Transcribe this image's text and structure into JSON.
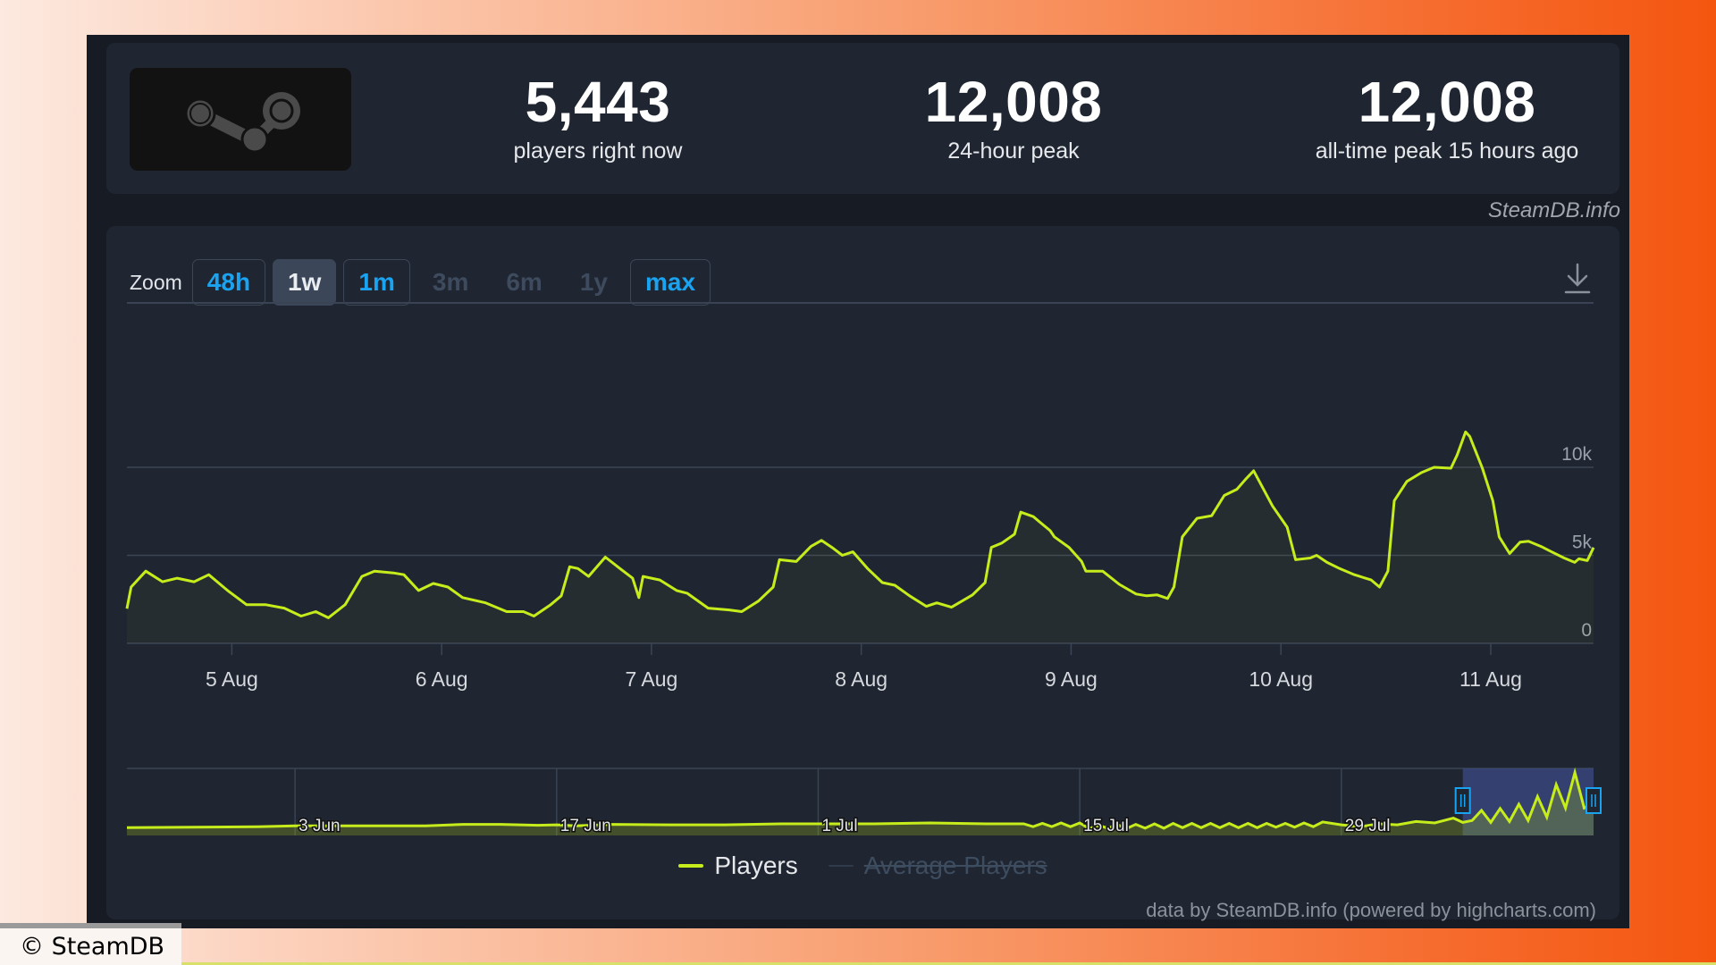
{
  "header": {
    "logo_icon": "steam-logo-icon",
    "stats": [
      {
        "value": "5,443",
        "label": "players right now"
      },
      {
        "value": "12,008",
        "label": "24-hour peak"
      },
      {
        "value": "12,008",
        "label": "all-time peak 15 hours ago"
      }
    ],
    "watermark": "SteamDB.info"
  },
  "toolbar": {
    "zoom_label": "Zoom",
    "zoom_buttons": [
      {
        "label": "48h",
        "state": "enabled"
      },
      {
        "label": "1w",
        "state": "active"
      },
      {
        "label": "1m",
        "state": "enabled"
      },
      {
        "label": "3m",
        "state": "disabled"
      },
      {
        "label": "6m",
        "state": "disabled"
      },
      {
        "label": "1y",
        "state": "disabled"
      },
      {
        "label": "max",
        "state": "enabled"
      }
    ],
    "download_icon": "download-icon"
  },
  "colors": {
    "series": "#c6ec1c",
    "accent": "#1aa3f0",
    "panel": "#1f2631",
    "navigator_selection": "#3c4a86"
  },
  "chart_data": {
    "type": "line",
    "title": "",
    "xlabel": "",
    "ylabel": "",
    "x_unit": "day of August (fractional)",
    "xlim": [
      4.5,
      11.49
    ],
    "ylim": [
      0,
      12500
    ],
    "grid": true,
    "y_ticks": [
      {
        "value": 0,
        "label": "0"
      },
      {
        "value": 5000,
        "label": "5k"
      },
      {
        "value": 10000,
        "label": "10k"
      }
    ],
    "x_ticks": [
      {
        "value": 5,
        "label": "5 Aug"
      },
      {
        "value": 6,
        "label": "6 Aug"
      },
      {
        "value": 7,
        "label": "7 Aug"
      },
      {
        "value": 8,
        "label": "8 Aug"
      },
      {
        "value": 9,
        "label": "9 Aug"
      },
      {
        "value": 10,
        "label": "10 Aug"
      },
      {
        "value": 11,
        "label": "11 Aug"
      }
    ],
    "series": [
      {
        "name": "Players",
        "visible": true,
        "points": [
          [
            4.5,
            1970
          ],
          [
            4.52,
            3200
          ],
          [
            4.59,
            4100
          ],
          [
            4.67,
            3500
          ],
          [
            4.74,
            3700
          ],
          [
            4.82,
            3500
          ],
          [
            4.89,
            3900
          ],
          [
            4.98,
            3000
          ],
          [
            5.07,
            2200
          ],
          [
            5.16,
            2200
          ],
          [
            5.25,
            2000
          ],
          [
            5.33,
            1550
          ],
          [
            5.4,
            1800
          ],
          [
            5.46,
            1450
          ],
          [
            5.54,
            2200
          ],
          [
            5.62,
            3800
          ],
          [
            5.68,
            4100
          ],
          [
            5.77,
            4000
          ],
          [
            5.82,
            3900
          ],
          [
            5.89,
            3000
          ],
          [
            5.96,
            3400
          ],
          [
            6.03,
            3200
          ],
          [
            6.1,
            2600
          ],
          [
            6.21,
            2300
          ],
          [
            6.31,
            1800
          ],
          [
            6.39,
            1800
          ],
          [
            6.44,
            1550
          ],
          [
            6.52,
            2200
          ],
          [
            6.57,
            2700
          ],
          [
            6.61,
            4350
          ],
          [
            6.65,
            4250
          ],
          [
            6.7,
            3800
          ],
          [
            6.78,
            4900
          ],
          [
            6.85,
            4250
          ],
          [
            6.91,
            3700
          ],
          [
            6.94,
            2600
          ],
          [
            6.96,
            3800
          ],
          [
            7.04,
            3600
          ],
          [
            7.12,
            3000
          ],
          [
            7.17,
            2850
          ],
          [
            7.27,
            2000
          ],
          [
            7.37,
            1900
          ],
          [
            7.43,
            1800
          ],
          [
            7.51,
            2400
          ],
          [
            7.58,
            3200
          ],
          [
            7.61,
            4750
          ],
          [
            7.69,
            4650
          ],
          [
            7.76,
            5500
          ],
          [
            7.81,
            5850
          ],
          [
            7.86,
            5450
          ],
          [
            7.91,
            5000
          ],
          [
            7.96,
            5200
          ],
          [
            8.03,
            4250
          ],
          [
            8.1,
            3450
          ],
          [
            8.16,
            3300
          ],
          [
            8.23,
            2700
          ],
          [
            8.31,
            2100
          ],
          [
            8.36,
            2300
          ],
          [
            8.43,
            2050
          ],
          [
            8.53,
            2750
          ],
          [
            8.59,
            3450
          ],
          [
            8.62,
            5450
          ],
          [
            8.67,
            5700
          ],
          [
            8.73,
            6200
          ],
          [
            8.76,
            7450
          ],
          [
            8.82,
            7200
          ],
          [
            8.85,
            6900
          ],
          [
            8.9,
            6400
          ],
          [
            8.92,
            6050
          ],
          [
            8.99,
            5450
          ],
          [
            9.05,
            4650
          ],
          [
            9.07,
            4100
          ],
          [
            9.15,
            4100
          ],
          [
            9.23,
            3350
          ],
          [
            9.31,
            2800
          ],
          [
            9.36,
            2700
          ],
          [
            9.41,
            2750
          ],
          [
            9.46,
            2550
          ],
          [
            9.49,
            3200
          ],
          [
            9.53,
            6050
          ],
          [
            9.6,
            7100
          ],
          [
            9.67,
            7250
          ],
          [
            9.73,
            8400
          ],
          [
            9.79,
            8750
          ],
          [
            9.83,
            9300
          ],
          [
            9.87,
            9800
          ],
          [
            9.96,
            7800
          ],
          [
            10.03,
            6600
          ],
          [
            10.07,
            4750
          ],
          [
            10.14,
            4850
          ],
          [
            10.17,
            5000
          ],
          [
            10.22,
            4600
          ],
          [
            10.28,
            4250
          ],
          [
            10.35,
            3900
          ],
          [
            10.43,
            3600
          ],
          [
            10.47,
            3200
          ],
          [
            10.51,
            4100
          ],
          [
            10.54,
            8100
          ],
          [
            10.6,
            9200
          ],
          [
            10.67,
            9700
          ],
          [
            10.73,
            10000
          ],
          [
            10.81,
            9950
          ],
          [
            10.84,
            10700
          ],
          [
            10.88,
            12008
          ],
          [
            10.9,
            11750
          ],
          [
            10.96,
            9950
          ],
          [
            11.01,
            8100
          ],
          [
            11.04,
            6050
          ],
          [
            11.09,
            5100
          ],
          [
            11.14,
            5750
          ],
          [
            11.18,
            5800
          ],
          [
            11.24,
            5500
          ],
          [
            11.29,
            5200
          ],
          [
            11.35,
            4850
          ],
          [
            11.4,
            4600
          ],
          [
            11.42,
            4800
          ],
          [
            11.46,
            4700
          ],
          [
            11.49,
            5443
          ]
        ]
      },
      {
        "name": "Average Players",
        "visible": false,
        "points": []
      }
    ],
    "legend": {
      "position": "bottom-center",
      "items": [
        {
          "label": "Players",
          "enabled": true
        },
        {
          "label": "Average Players",
          "enabled": false
        }
      ]
    },
    "navigator": {
      "x_unit": "days since 1 Jun",
      "xlim": [
        -7,
        71.5
      ],
      "ylim": [
        0,
        12500
      ],
      "x_ticks": [
        {
          "value": 2,
          "label": "3 Jun"
        },
        {
          "value": 16,
          "label": "17 Jun"
        },
        {
          "value": 30,
          "label": "1 Jul"
        },
        {
          "value": 44,
          "label": "15 Jul"
        },
        {
          "value": 58,
          "label": "29 Jul"
        }
      ],
      "selection": [
        64.5,
        71.5
      ],
      "points": [
        [
          -7,
          500
        ],
        [
          0,
          700
        ],
        [
          2,
          900
        ],
        [
          6,
          900
        ],
        [
          9,
          900
        ],
        [
          11,
          1200
        ],
        [
          13,
          1200
        ],
        [
          15,
          1000
        ],
        [
          16,
          1100
        ],
        [
          17,
          900
        ],
        [
          19,
          1200
        ],
        [
          22,
          1100
        ],
        [
          25,
          1100
        ],
        [
          28,
          1300
        ],
        [
          30,
          1300
        ],
        [
          33,
          1300
        ],
        [
          36,
          1500
        ],
        [
          39,
          1300
        ],
        [
          41,
          1300
        ],
        [
          41.5,
          700
        ],
        [
          42,
          1400
        ],
        [
          42.5,
          700
        ],
        [
          43,
          1500
        ],
        [
          43.5,
          700
        ],
        [
          44,
          1500
        ],
        [
          44.5,
          300
        ],
        [
          45,
          1000
        ],
        [
          45.5,
          400
        ],
        [
          46,
          1200
        ],
        [
          46.5,
          300
        ],
        [
          47,
          1200
        ],
        [
          47.5,
          400
        ],
        [
          48,
          1300
        ],
        [
          48.5,
          400
        ],
        [
          49,
          1400
        ],
        [
          49.5,
          500
        ],
        [
          50,
          1400
        ],
        [
          50.5,
          500
        ],
        [
          51,
          1400
        ],
        [
          51.5,
          500
        ],
        [
          52,
          1400
        ],
        [
          52.5,
          500
        ],
        [
          53,
          1400
        ],
        [
          53.5,
          500
        ],
        [
          54,
          1400
        ],
        [
          54.5,
          600
        ],
        [
          55,
          1400
        ],
        [
          55.5,
          600
        ],
        [
          56,
          1500
        ],
        [
          56.5,
          700
        ],
        [
          57,
          1700
        ],
        [
          58,
          1100
        ],
        [
          59,
          700
        ],
        [
          60,
          1300
        ],
        [
          61,
          1100
        ],
        [
          62,
          1800
        ],
        [
          63,
          1500
        ],
        [
          64,
          2500
        ],
        [
          64.5,
          1600
        ],
        [
          65,
          2000
        ],
        [
          65.5,
          4100
        ],
        [
          66,
          1600
        ],
        [
          66.5,
          4500
        ],
        [
          67,
          1800
        ],
        [
          67.5,
          5400
        ],
        [
          68,
          2000
        ],
        [
          68.5,
          7000
        ],
        [
          69,
          2700
        ],
        [
          69.5,
          9500
        ],
        [
          70,
          4600
        ],
        [
          70.5,
          12008
        ],
        [
          71,
          4600
        ],
        [
          71.5,
          5400
        ]
      ]
    }
  },
  "legend_labels": {
    "players": "Players",
    "average": "Average Players"
  },
  "footer": {
    "credits": "data by SteamDB.info (powered by highcharts.com)",
    "copyright": "© SteamDB"
  }
}
